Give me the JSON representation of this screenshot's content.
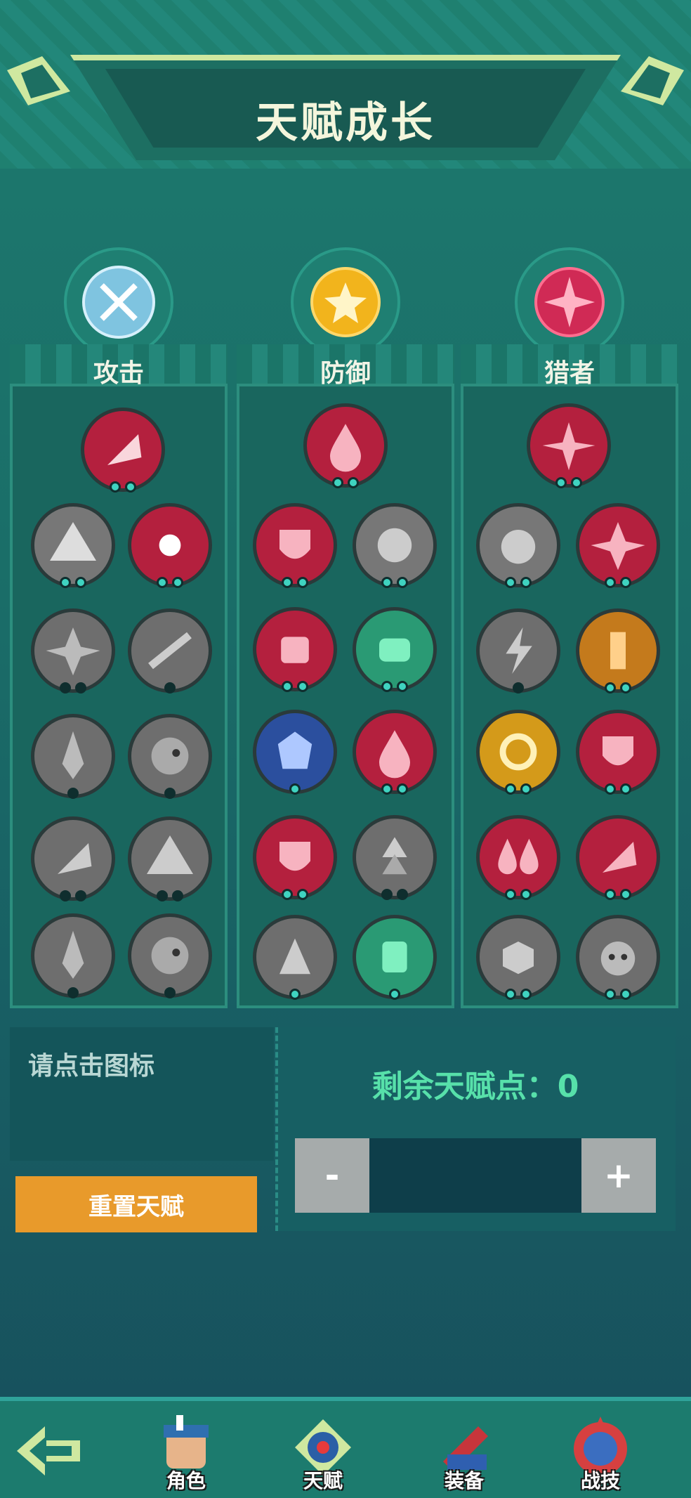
{
  "page": {
    "title": "天赋成长"
  },
  "trees": [
    {
      "label": "攻击"
    },
    {
      "label": "防御"
    },
    {
      "label": "猎者"
    }
  ],
  "info": {
    "hint": "请点击图标"
  },
  "actions": {
    "reset_label": "重置天赋"
  },
  "points": {
    "remaining_label": "剩余天赋点：",
    "remaining_value": "0",
    "minus_label": "-",
    "plus_label": "+"
  },
  "nav": {
    "items": [
      {
        "label": "角色"
      },
      {
        "label": "天赋"
      },
      {
        "label": "装备"
      },
      {
        "label": "战技"
      }
    ]
  },
  "colors": {
    "accent": "#3fd3c0",
    "reset": "#e89a2b",
    "points_text": "#57e0aa"
  }
}
